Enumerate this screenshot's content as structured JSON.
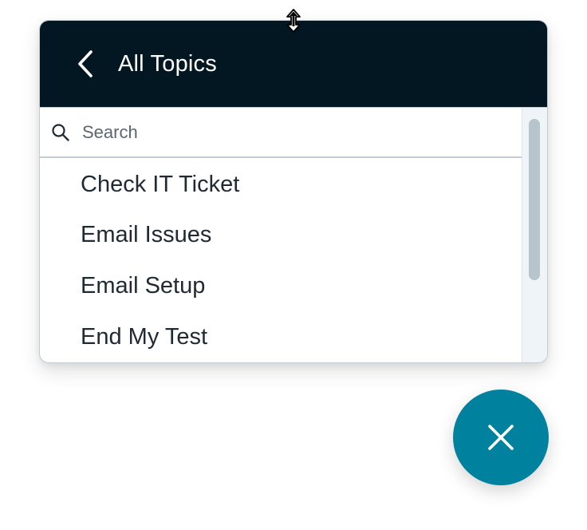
{
  "header": {
    "title": "All Topics",
    "background_color": "#031722",
    "back_icon": "chevron-left-icon"
  },
  "search": {
    "placeholder": "Search",
    "value": "",
    "icon": "search-icon"
  },
  "topics": [
    {
      "label": "Check IT Ticket"
    },
    {
      "label": "Email Issues"
    },
    {
      "label": "Email Setup"
    },
    {
      "label": "End My Test"
    }
  ],
  "close_button": {
    "icon": "close-icon",
    "color": "#00829f"
  },
  "cursor": {
    "icon": "resize-vertical-cursor-icon"
  }
}
